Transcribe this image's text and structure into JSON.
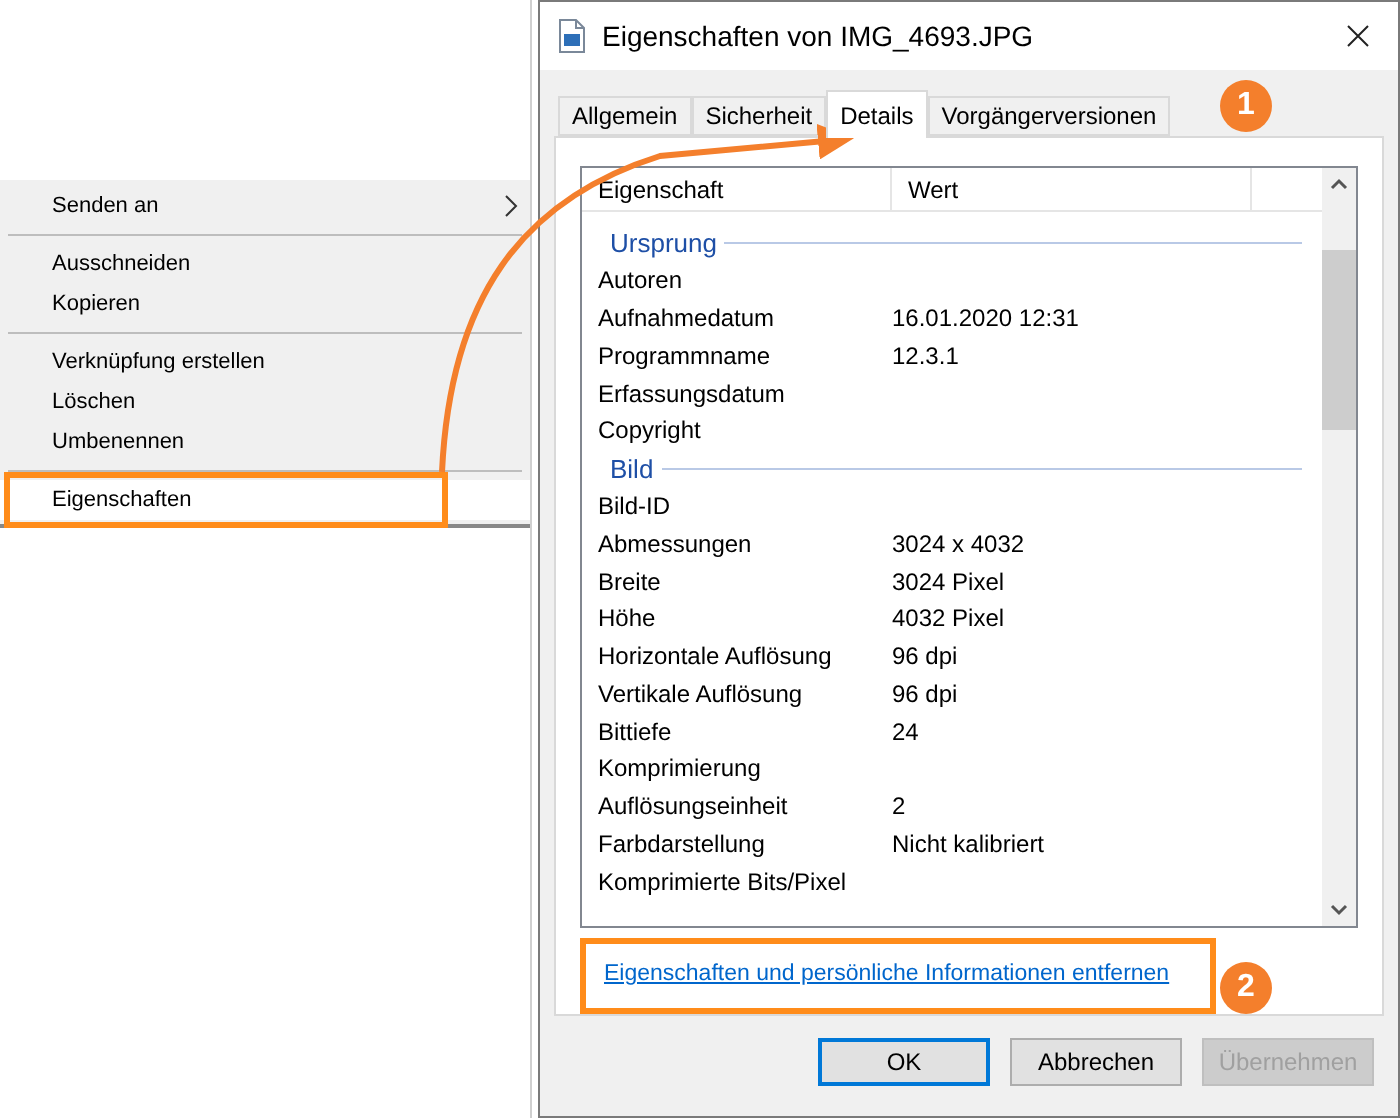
{
  "context_menu": {
    "items": [
      {
        "label": "Senden an",
        "kind": "submenu",
        "selected": false
      },
      {
        "kind": "separator"
      },
      {
        "label": "Ausschneiden",
        "kind": "item",
        "selected": false
      },
      {
        "label": "Kopieren",
        "kind": "item",
        "selected": false
      },
      {
        "kind": "separator"
      },
      {
        "label": "Verknüpfung erstellen",
        "kind": "item",
        "selected": false
      },
      {
        "label": "Löschen",
        "kind": "item",
        "selected": false
      },
      {
        "label": "Umbenennen",
        "kind": "item",
        "selected": false
      },
      {
        "kind": "separator"
      },
      {
        "label": "Eigenschaften",
        "kind": "item",
        "selected": true
      }
    ]
  },
  "window": {
    "title": "Eigenschaften von IMG_4693.JPG"
  },
  "tabs": [
    {
      "label": "Allgemein",
      "selected": false
    },
    {
      "label": "Sicherheit",
      "selected": false
    },
    {
      "label": "Details",
      "selected": true
    },
    {
      "label": "Vorgängerversionen",
      "selected": false
    }
  ],
  "details": {
    "columns": [
      "Eigenschaft",
      "Wert"
    ],
    "rows": [
      {
        "kind": "section",
        "label": "Ursprung"
      },
      {
        "kind": "row",
        "label": "Autoren"
      },
      {
        "kind": "row",
        "label": "Aufnahmedatum",
        "value": "16.01.2020 12:31"
      },
      {
        "kind": "row",
        "label": "Programmname",
        "value": "12.3.1"
      },
      {
        "kind": "row",
        "label": "Erfassungsdatum"
      },
      {
        "kind": "row",
        "label": "Copyright"
      },
      {
        "kind": "section",
        "label": "Bild"
      },
      {
        "kind": "row",
        "label": "Bild-ID"
      },
      {
        "kind": "row",
        "label": "Abmessungen",
        "value": "3024 x 4032"
      },
      {
        "kind": "row",
        "label": "Breite",
        "value": "3024 Pixel"
      },
      {
        "kind": "row",
        "label": "Höhe",
        "value": "4032 Pixel"
      },
      {
        "kind": "row",
        "label": "Horizontale Auflösung",
        "value": "96 dpi"
      },
      {
        "kind": "row",
        "label": "Vertikale Auflösung",
        "value": "96 dpi"
      },
      {
        "kind": "row",
        "label": "Bittiefe",
        "value": "24"
      },
      {
        "kind": "row",
        "label": "Komprimierung"
      },
      {
        "kind": "row",
        "label": "Auflösungseinheit",
        "value": "2"
      },
      {
        "kind": "row",
        "label": "Farbdarstellung",
        "value": "Nicht kalibriert"
      },
      {
        "kind": "row",
        "label": "Komprimierte Bits/Pixel"
      }
    ]
  },
  "link": "Eigenschaften und persönliche Informationen entfernen",
  "buttons": [
    {
      "label": "OK",
      "kind": "default",
      "disabled": false
    },
    {
      "label": "Abbrechen",
      "kind": "normal",
      "disabled": false
    },
    {
      "label": "Übernehmen",
      "kind": "normal",
      "disabled": true
    }
  ],
  "callouts": [
    "1",
    "2"
  ]
}
